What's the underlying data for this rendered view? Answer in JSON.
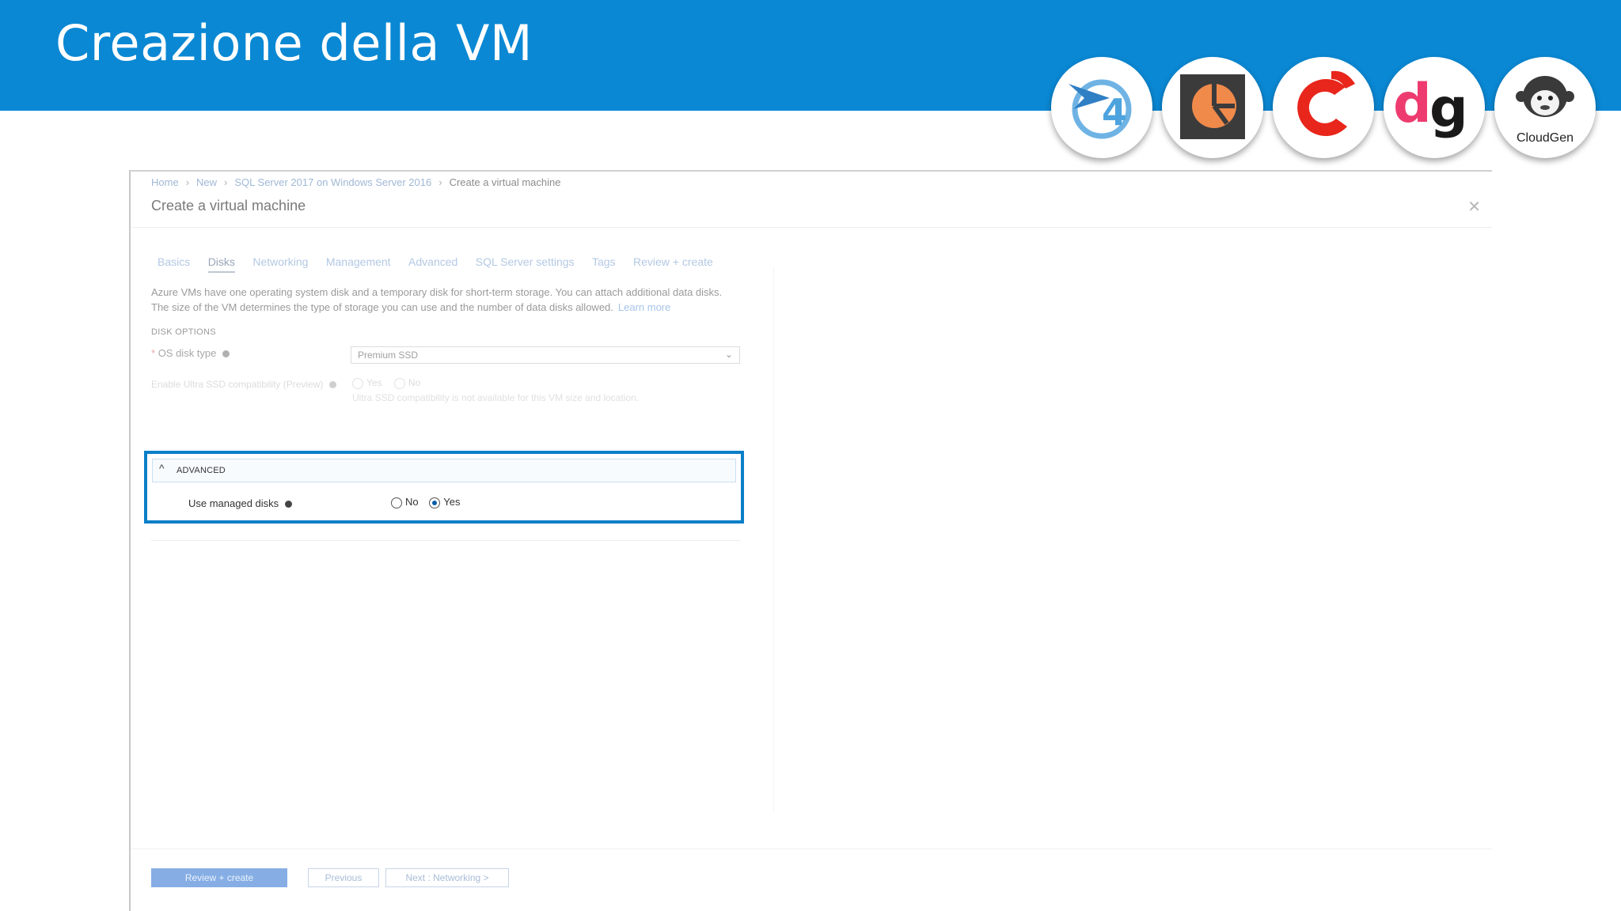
{
  "slide": {
    "title": "Creazione della VM",
    "header_color": "#0a88d4",
    "logos": [
      {
        "icon": "cloud-4-logo-icon"
      },
      {
        "icon": "orange-pie-logo-icon"
      },
      {
        "icon": "red-c-logo-icon"
      },
      {
        "icon": "dg-logo-icon"
      },
      {
        "icon": "cloudgen-monkey-logo-icon",
        "text": "CloudGen"
      }
    ]
  },
  "portal": {
    "breadcrumb": [
      "Home",
      "New",
      "SQL Server 2017 on Windows Server 2016",
      "Create a virtual machine"
    ],
    "title": "Create a virtual machine",
    "tabs": [
      "Basics",
      "Disks",
      "Networking",
      "Management",
      "Advanced",
      "SQL Server settings",
      "Tags",
      "Review + create"
    ],
    "active_tab": "Disks",
    "description_line1": "Azure VMs have one operating system disk and a temporary disk for short-term storage. You can attach additional data disks.",
    "description_line2": "The size of the VM determines the type of storage you can use and the number of data disks allowed.",
    "learn_more": "Learn more",
    "disk_options": {
      "section_label": "DISK OPTIONS",
      "os_disk_label": "OS disk type",
      "os_disk_value": "Premium SSD",
      "ultra_label": "Enable Ultra SSD compatibility (Preview)",
      "ultra_yes": "Yes",
      "ultra_no": "No",
      "ultra_note": "Ultra SSD compatibility is not available for this VM size and location."
    },
    "advanced": {
      "header": "ADVANCED",
      "managed_disks_label": "Use managed disks",
      "option_no": "No",
      "option_yes": "Yes",
      "selected": "Yes",
      "highlight_color": "#0a7fc8"
    },
    "footer": {
      "review_create": "Review + create",
      "previous": "Previous",
      "next": "Next : Networking >"
    }
  }
}
